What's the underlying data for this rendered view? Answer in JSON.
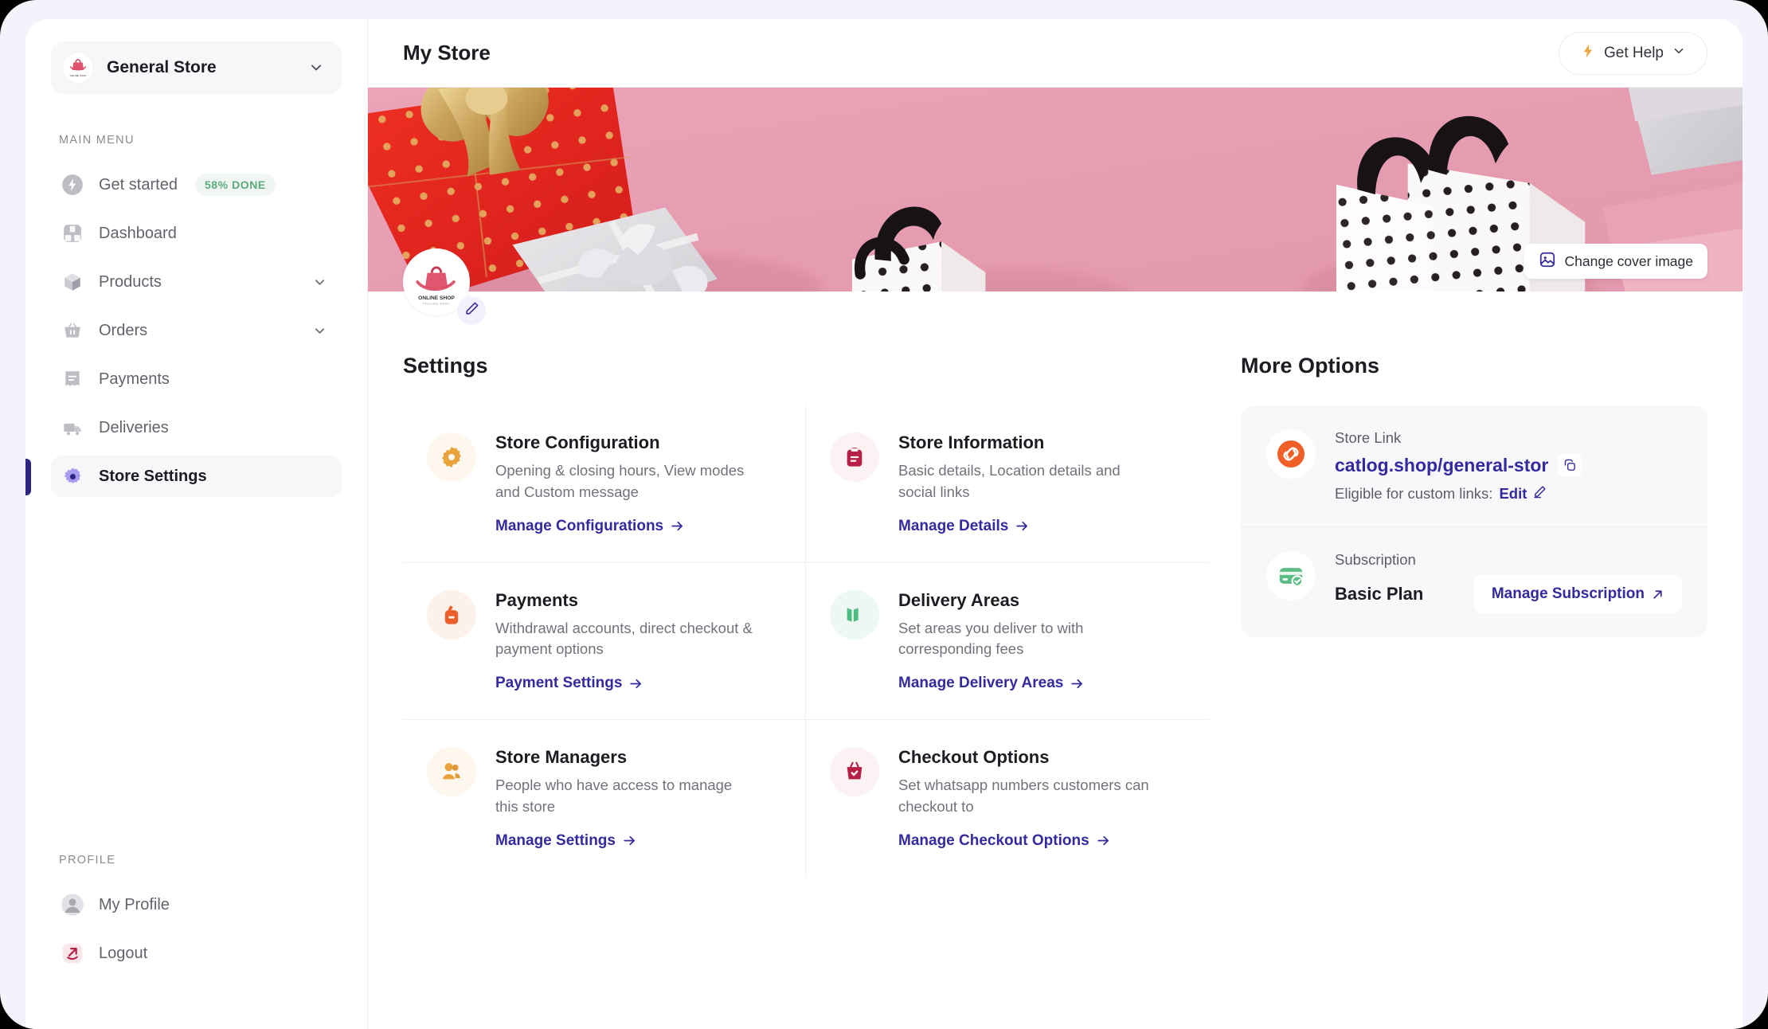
{
  "sidebar": {
    "store_switcher": {
      "name": "General Store",
      "chevron_icon": "chevron-down-icon",
      "avatar_icon": "store-logo"
    },
    "main_menu_label": "MAIN MENU",
    "profile_label": "PROFILE",
    "items": [
      {
        "label": "Get started",
        "icon": "lightning-bolt-icon",
        "badge": "58% DONE",
        "expandable": false,
        "active": false
      },
      {
        "label": "Dashboard",
        "icon": "dashboard-icon",
        "badge": null,
        "expandable": false,
        "active": false
      },
      {
        "label": "Products",
        "icon": "box-icon",
        "badge": null,
        "expandable": true,
        "active": false
      },
      {
        "label": "Orders",
        "icon": "basket-icon",
        "badge": null,
        "expandable": true,
        "active": false
      },
      {
        "label": "Payments",
        "icon": "receipt-icon",
        "badge": null,
        "expandable": false,
        "active": false
      },
      {
        "label": "Deliveries",
        "icon": "truck-icon",
        "badge": null,
        "expandable": false,
        "active": false
      },
      {
        "label": "Store Settings",
        "icon": "gear-icon",
        "badge": null,
        "expandable": false,
        "active": true
      }
    ],
    "profile_items": [
      {
        "label": "My Profile",
        "icon": "user-avatar-icon"
      },
      {
        "label": "Logout",
        "icon": "logout-arrow-icon"
      }
    ]
  },
  "header": {
    "title": "My Store",
    "get_help_label": "Get Help",
    "get_help_icon": "lightning-bolt-icon",
    "get_help_chevron": "chevron-down-icon"
  },
  "cover": {
    "change_cover_label": "Change cover image",
    "change_cover_icon": "image-icon",
    "logo_edit_icon": "pencil-icon",
    "logo_text_primary": "ONLINE SHOP",
    "logo_text_secondary": "TAGLINE HERE"
  },
  "settings": {
    "heading": "Settings",
    "cards": [
      {
        "title": "Store Configuration",
        "desc": "Opening & closing hours, View modes and Custom message",
        "link": "Manage Configurations",
        "icon": "gear-icon",
        "icon_color": "#e8a33d",
        "icon_bg": "#fdf7ed"
      },
      {
        "title": "Store Information",
        "desc": "Basic details, Location details and social links",
        "link": "Manage Details",
        "icon": "clipboard-icon",
        "icon_color": "#b52044",
        "icon_bg": "#fcf1f3"
      },
      {
        "title": "Payments",
        "desc": "Withdrawal accounts, direct checkout & payment options",
        "link": "Payment Settings",
        "icon": "wallet-icon",
        "icon_color": "#ec5e2a",
        "icon_bg": "#fdf1ec"
      },
      {
        "title": "Delivery Areas",
        "desc": "Set areas you deliver to with corresponding fees",
        "link": "Manage Delivery Areas",
        "icon": "map-fold-icon",
        "icon_color": "#4fbb82",
        "icon_bg": "#eef8f2"
      },
      {
        "title": "Store Managers",
        "desc": "People who have access to manage this store",
        "link": "Manage Settings",
        "icon": "people-icon",
        "icon_color": "#e8a33d",
        "icon_bg": "#fdf7ed"
      },
      {
        "title": "Checkout Options",
        "desc": "Set whatsapp numbers customers can checkout to",
        "link": "Manage Checkout Options",
        "icon": "checkout-basket-icon",
        "icon_color": "#b52044",
        "icon_bg": "#fcf1f3"
      }
    ],
    "arrow_icon": "arrow-right-icon"
  },
  "more_options": {
    "heading": "More Options",
    "store_link": {
      "label": "Store Link",
      "url": "catlog.shop/general-stor",
      "copy_icon": "copy-icon",
      "eligible_text": "Eligible for custom links:",
      "edit_label": "Edit",
      "edit_icon": "pencil-icon",
      "icon": "link-icon",
      "icon_color": "#ef5f27"
    },
    "subscription": {
      "label": "Subscription",
      "plan": "Basic Plan",
      "button_label": "Manage Subscription",
      "button_icon": "arrow-up-right-icon",
      "icon": "card-check-icon",
      "icon_color": "#5bbd84"
    }
  },
  "colors": {
    "accent_purple": "#342a9e",
    "active_bar": "#2e2580",
    "page_bg": "#f4f3fc",
    "badge_green": "#5bab7d"
  }
}
